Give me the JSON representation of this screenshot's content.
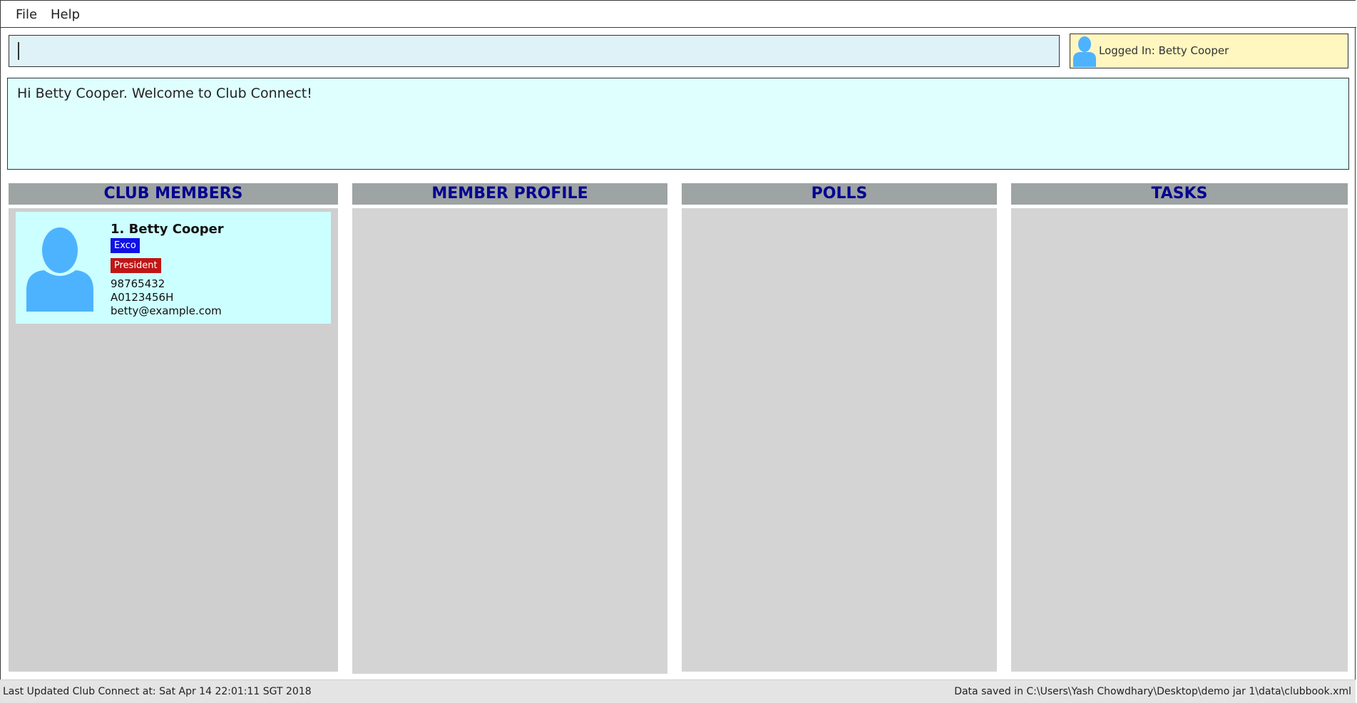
{
  "menu": {
    "file": "File",
    "help": "Help"
  },
  "command_box": {
    "value": ""
  },
  "logged_in": {
    "text": "Logged In: Betty Cooper"
  },
  "result_display": {
    "text": "Hi Betty Cooper. Welcome to Club Connect!"
  },
  "panels": {
    "club_members": "CLUB MEMBERS",
    "member_profile": "MEMBER PROFILE",
    "polls": "POLLS",
    "tasks": "TASKS"
  },
  "members": [
    {
      "index_name": "1.  Betty Cooper",
      "tags": [
        "Exco",
        "President"
      ],
      "phone": "98765432",
      "matric": "A0123456H",
      "email": "betty@example.com"
    }
  ],
  "status_bar": {
    "last_updated": "Last Updated Club Connect at: Sat Apr 14 22:01:11 SGT 2018",
    "data_saved": "Data saved in C:\\Users\\Yash Chowdhary\\Desktop\\demo jar 1\\data\\clubbook.xml"
  },
  "colors": {
    "accent_header_text": "#050591",
    "panel_header_bg": "#9ea3a3",
    "card_bg": "#ccffff",
    "tag_exco": "#1010e6",
    "tag_president": "#c01515",
    "avatar": "#4db3ff"
  }
}
